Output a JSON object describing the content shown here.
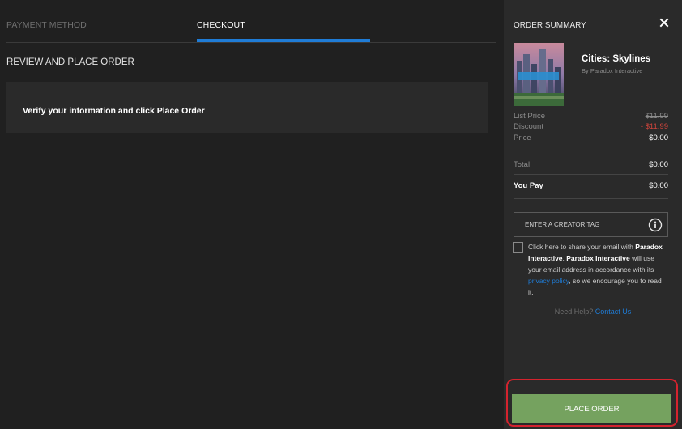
{
  "tabs": [
    {
      "label": "PAYMENT METHOD",
      "active": false
    },
    {
      "label": "CHECKOUT",
      "active": true
    }
  ],
  "review": {
    "title": "REVIEW AND PLACE ORDER",
    "message": "Verify your information and click Place Order"
  },
  "summary": {
    "title": "ORDER SUMMARY",
    "close_icon": "close-icon",
    "product": {
      "name": "Cities: Skylines",
      "publisher": "By Paradox Interactive",
      "thumbnail_icon": "game-cover-image"
    },
    "rows": {
      "list_price": {
        "label": "List Price",
        "value": "$11.99"
      },
      "discount": {
        "label": "Discount",
        "value": "- $11.99"
      },
      "price": {
        "label": "Price",
        "value": "$0.00"
      },
      "total": {
        "label": "Total",
        "value": "$0.00"
      },
      "you_pay": {
        "label": "You Pay",
        "value": "$0.00"
      }
    },
    "creator_tag": {
      "placeholder": "ENTER A CREATOR TAG",
      "value": "",
      "icon": "info-icon"
    },
    "consent": {
      "checked": false,
      "text_1": "Click here to share your email with ",
      "company_1": "Paradox Interactive",
      "text_2": ". ",
      "company_2": "Paradox Interactive",
      "text_3": " will use your email address in accordance with its ",
      "link": "privacy policy",
      "text_4": ", so we encourage you to read it."
    },
    "help": {
      "text": "Need Help? ",
      "link": "Contact Us"
    },
    "place_order_label": "PLACE ORDER"
  },
  "colors": {
    "accent_blue": "#1f7cd6",
    "button_green": "#75a25f",
    "discount_red": "#d0453c",
    "highlight_red": "#d4232e",
    "page_bg": "#202020",
    "panel_bg": "#2a2a2a"
  }
}
